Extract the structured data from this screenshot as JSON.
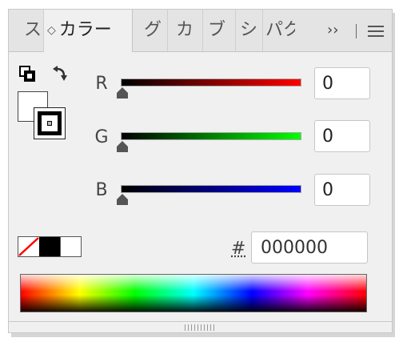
{
  "panel": {
    "tabs": [
      {
        "label": "ス"
      },
      {
        "label": "カラー",
        "active": true,
        "arrow": "◇"
      },
      {
        "label": "グ"
      },
      {
        "label": "カ"
      },
      {
        "label": "ブ"
      },
      {
        "label": "シ"
      },
      {
        "label": "パク"
      }
    ],
    "overflow_label": "››",
    "menu_icon": "hamburger-menu-icon"
  },
  "color": {
    "fill_color": "#ffffff",
    "stroke_color": "#000000",
    "channels": [
      {
        "label": "R",
        "value": "0",
        "gradient_end": "#ff0000"
      },
      {
        "label": "G",
        "value": "0",
        "gradient_end": "#00ff00"
      },
      {
        "label": "B",
        "value": "0",
        "gradient_end": "#0000ff"
      }
    ],
    "hash_label": "#",
    "hex_value": "000000",
    "quick_swatches": [
      "none",
      "#000000",
      "#ffffff"
    ]
  },
  "icons": {
    "default_colors": "default-fill-stroke-icon",
    "swap": "swap-fill-stroke-icon",
    "resize_grip": "resize-grip-icon"
  }
}
